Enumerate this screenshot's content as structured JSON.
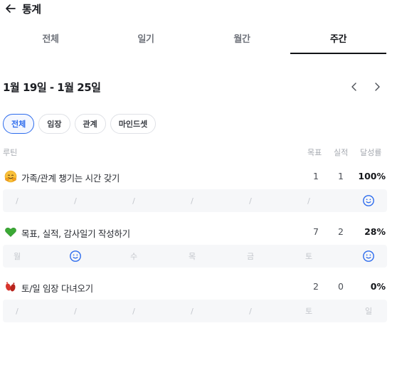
{
  "header": {
    "title": "통계"
  },
  "tabs": [
    {
      "label": "전체",
      "active": false
    },
    {
      "label": "일기",
      "active": false
    },
    {
      "label": "월간",
      "active": false
    },
    {
      "label": "주간",
      "active": true
    }
  ],
  "range": {
    "label": "1월 19일 - 1월 25일"
  },
  "filters": [
    {
      "label": "전체",
      "active": true
    },
    {
      "label": "임장",
      "active": false
    },
    {
      "label": "관계",
      "active": false
    },
    {
      "label": "마인드셋",
      "active": false
    }
  ],
  "columns": {
    "routine": "루틴",
    "goal": "목표",
    "actual": "실적",
    "rate": "달성률"
  },
  "routines": [
    {
      "icon": "hugging-face-emoji-icon",
      "title": "가족/관계 챙기는 시간 갖기",
      "goal": "1",
      "actual": "1",
      "rate": "100%",
      "days": [
        "/",
        "/",
        "/",
        "/",
        "/",
        "/",
        "done"
      ]
    },
    {
      "icon": "green-heart-emoji-icon",
      "title": "목표, 실적, 감사일기 작성하기",
      "goal": "7",
      "actual": "2",
      "rate": "28%",
      "days": [
        "월",
        "done",
        "수",
        "목",
        "금",
        "토",
        "done"
      ]
    },
    {
      "icon": "footprints-emoji-icon",
      "title": "토/일 임장 다녀오기",
      "goal": "2",
      "actual": "0",
      "rate": "0%",
      "days": [
        "/",
        "/",
        "/",
        "/",
        "/",
        "토",
        "일"
      ]
    }
  ],
  "colors": {
    "accent": "#2c6bed",
    "strip": "#f6f7f9",
    "muted": "#c3c6cc"
  }
}
